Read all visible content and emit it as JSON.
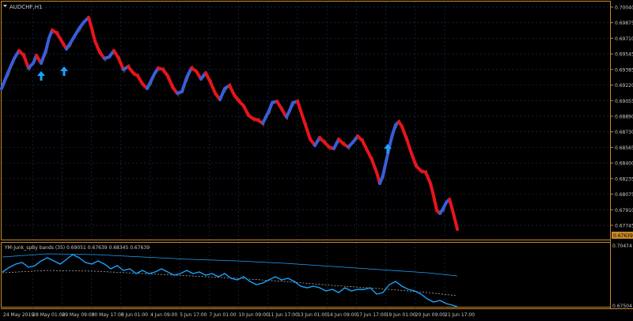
{
  "main_chart": {
    "title": "AUDCHF,H1",
    "price_labels": [
      "0.70040",
      "0.69875",
      "0.69710",
      "0.69545",
      "0.69385",
      "0.69220",
      "0.69055",
      "0.68890",
      "0.68730",
      "0.68565",
      "0.68400",
      "0.68235",
      "0.68075",
      "0.67910",
      "0.67745"
    ],
    "current_price": "0.67639",
    "arrow_icon": "up-arrow-icon"
  },
  "indicator": {
    "title": "YM-Junk_spBy bands (35) 0.69051 0.67639 0.68345 0.67639",
    "scale_top": "0.70474",
    "scale_bottom": "0.67504"
  },
  "time_axis": {
    "labels": [
      "24 May 2019",
      "28 May 01:00",
      "29 May 09:00",
      "30 May 17:00",
      "3 Jun 01:00",
      "4 Jun 09:00",
      "5 Jun 17:00",
      "7 Jun 01:00",
      "10 Jun 09:00",
      "11 Jun 17:00",
      "13 Jun 01:00",
      "14 Jun 09:00",
      "17 Jun 17:00",
      "19 Jun 01:00",
      "20 Jun 09:00",
      "21 Jun 17:00"
    ]
  },
  "colors": {
    "background": "#000000",
    "frame": "#c88a2a",
    "grid": "#1e2a55",
    "up_segment": "#3a5ed8",
    "down_segment": "#e8141c",
    "price_line": "#c88a2a",
    "arrow": "#1aa3ff",
    "indicator_line": "#1aa3ff",
    "indicator_upper": "#1aa3ff",
    "indicator_lower": "#c0c0c0",
    "price_box": "#c88a2a"
  }
}
